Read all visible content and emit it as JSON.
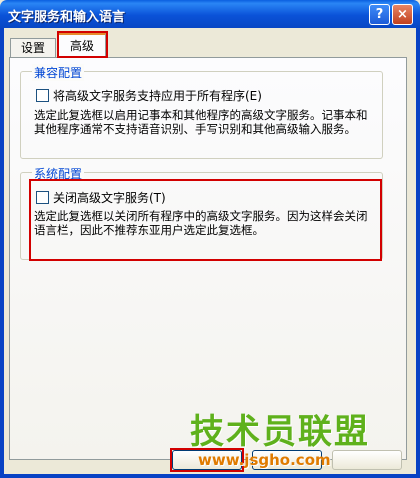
{
  "window": {
    "title": "文字服务和输入语言",
    "help_label": "?",
    "close_label": "×"
  },
  "tabs": [
    {
      "label": "设置"
    },
    {
      "label": "高级"
    }
  ],
  "compat": {
    "group_title": "兼容配置",
    "checkbox_label": "将高级文字服务支持应用于所有程序(E)",
    "description": "选定此复选框以启用记事本和其他程序的高级文字服务。记事本和其他程序通常不支持语音识别、手写识别和其他高级输入服务。",
    "checked": false
  },
  "system": {
    "group_title": "系统配置",
    "checkbox_label": "关闭高级文字服务(T)",
    "description": "选定此复选框以关闭所有程序中的高级文字服务。因为这样会关闭语言栏，因此不推荐东亚用户选定此复选框。",
    "checked": false
  },
  "buttons": {
    "ok": "",
    "cancel": "",
    "apply": ""
  },
  "watermark": {
    "main": "技术员联盟",
    "sub": "www.jsgho.com"
  },
  "colors": {
    "titlebar": "#0a52d8",
    "highlight": "#d20000",
    "group_title": "#0046d5",
    "watermark_green": "#5fb11c",
    "watermark_orange": "#e07b00"
  }
}
